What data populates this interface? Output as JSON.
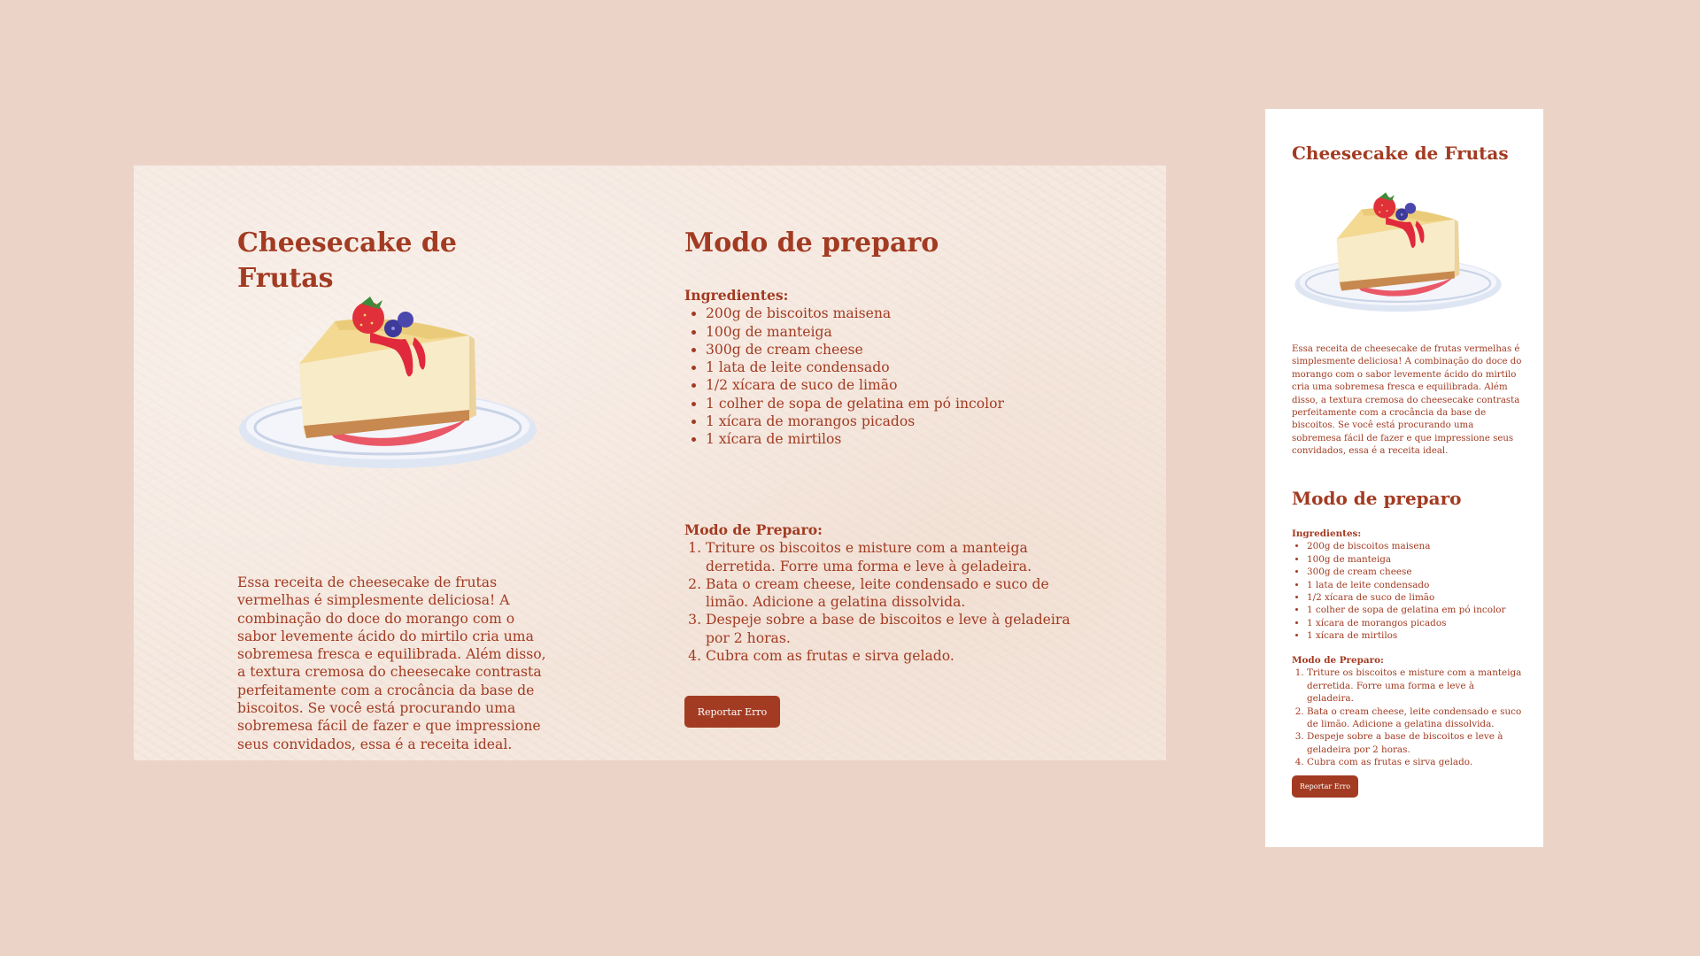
{
  "recipe": {
    "title": "Cheesecake de Frutas",
    "description": "Essa receita de cheesecake de frutas vermelhas é simplesmente deliciosa! A combinação do doce do morango com o sabor levemente ácido do mirtilo cria uma sobremesa fresca e equilibrada. Além disso, a textura cremosa do cheesecake contrasta perfeitamente com a crocância da base de biscoitos. Se você está procurando uma sobremesa fácil de fazer e que impressione seus convidados, essa é a receita ideal.",
    "method_title": "Modo de preparo",
    "ingredients_label": "Ingredientes:",
    "ingredients": [
      "200g de biscoitos maisena",
      "100g de manteiga",
      "300g de cream cheese",
      "1 lata de leite condensado",
      "1/2 xícara de suco de limão",
      "1 colher de sopa de gelatina em pó incolor",
      "1 xícara de morangos picados",
      "1 xícara de mirtilos"
    ],
    "steps_label": "Modo de Preparo:",
    "steps": [
      "Triture os biscoitos e misture com a manteiga derretida. Forre uma forma e leve à geladeira.",
      "Bata o cream cheese, leite condensado e suco de limão. Adicione a gelatina dissolvida.",
      "Despeje sobre a base de biscoitos e leve à geladeira por 2 horas.",
      "Cubra com as frutas e sirva gelado."
    ],
    "report_button": "Reportar Erro"
  },
  "colors": {
    "accent": "#a23b22",
    "background": "#ecd3c8",
    "card_desktop": "#f5e8df",
    "card_mobile": "#ffffff"
  },
  "icons": {
    "cake_image": "cheesecake-illustration"
  }
}
